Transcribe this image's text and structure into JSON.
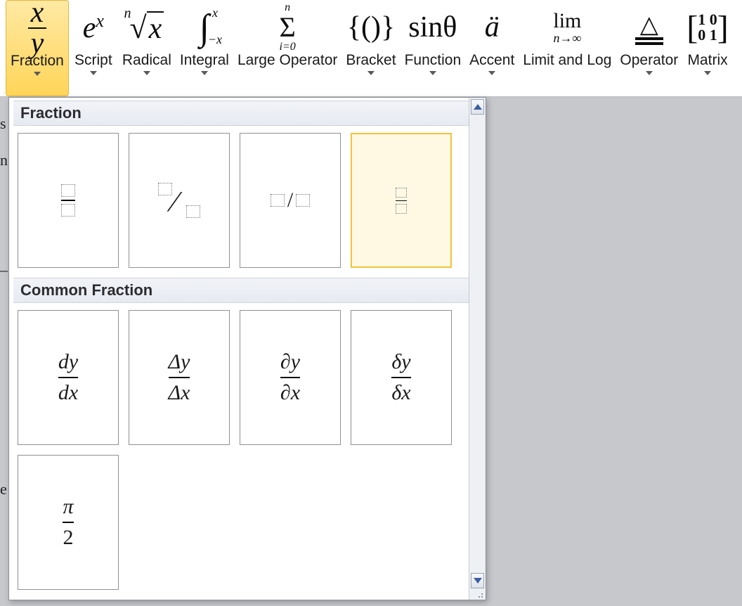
{
  "toolbar": {
    "items": [
      {
        "label": "Fraction",
        "icon_num": "x",
        "icon_den": "y"
      },
      {
        "label": "Script"
      },
      {
        "label": "Radical"
      },
      {
        "label": "Integral"
      },
      {
        "label": "Large Operator"
      },
      {
        "label": "Bracket"
      },
      {
        "label": "Function"
      },
      {
        "label": "Accent"
      },
      {
        "label": "Limit and Log"
      },
      {
        "label": "Operator"
      },
      {
        "label": "Matrix"
      }
    ]
  },
  "panel": {
    "groups": [
      {
        "title": "Fraction",
        "tiles": [
          {
            "name": "stacked-fraction"
          },
          {
            "name": "skewed-fraction"
          },
          {
            "name": "linear-fraction"
          },
          {
            "name": "small-fraction",
            "hover": true
          }
        ]
      },
      {
        "title": "Common Fraction",
        "tiles": [
          {
            "name": "dy-dx",
            "num": "dy",
            "den": "dx"
          },
          {
            "name": "Delta-y-Delta-x",
            "num": "Δy",
            "den": "Δx"
          },
          {
            "name": "partial-y-partial-x",
            "num": "∂y",
            "den": "∂x"
          },
          {
            "name": "delta-y-delta-x",
            "num": "δy",
            "den": "δx"
          },
          {
            "name": "pi-over-2",
            "num": "π",
            "den": "2"
          }
        ]
      }
    ]
  },
  "icons": {
    "script": "eˣ",
    "func": "sinθ",
    "accent": "ä",
    "bracket": "{()}"
  }
}
